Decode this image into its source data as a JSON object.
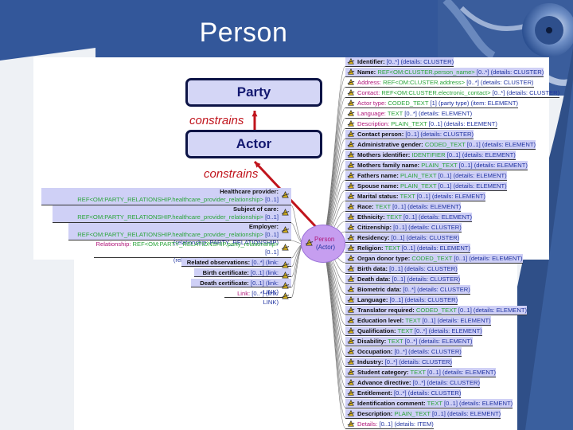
{
  "slide": {
    "title": "Person",
    "colors": {
      "header_blue": "#33579a",
      "node_fill": "#cfd0f6",
      "arrow_red": "#c0141c",
      "center_fill": "#c69ef0"
    }
  },
  "hierarchy": {
    "boxes": [
      {
        "label": "Party"
      },
      {
        "label": "Actor"
      }
    ],
    "relations": [
      {
        "label": "constrains"
      },
      {
        "label": "constrains"
      }
    ]
  },
  "mindmap": {
    "center": {
      "title": "Person",
      "subtitle": "(Actor)",
      "icon": "compass-icon"
    },
    "right_nodes": [
      {
        "label": "Identifier:",
        "type": "",
        "ext": "[0..*] (details: CLUSTER)",
        "hl": true,
        "mag": false
      },
      {
        "label": "Name:",
        "type": "REF<OM:CLUSTER.person_name>",
        "ext": "[0..*] (details: CLUSTER)",
        "hl": true,
        "mag": false
      },
      {
        "label": "Address:",
        "type": "REF<OM:CLUSTER.address>",
        "ext": "[0..*] (details: CLUSTER)",
        "hl": false,
        "mag": true
      },
      {
        "label": "Contact:",
        "type": "REF<OM:CLUSTER.electronic_contact>",
        "ext": "[0..*] (details: CLUSTER)",
        "hl": false,
        "mag": true
      },
      {
        "label": "Actor type:",
        "type": "CODED_TEXT",
        "ext": "[1] (party type) (item: ELEMENT)",
        "hl": false,
        "mag": true
      },
      {
        "label": "Language:",
        "type": "TEXT",
        "ext": "[0..*] (details: ELEMENT)",
        "hl": false,
        "mag": true
      },
      {
        "label": "Description:",
        "type": "PLAIN_TEXT",
        "ext": "[0..1] (details: ELEMENT)",
        "hl": false,
        "mag": true
      },
      {
        "label": "Contact person:",
        "type": "",
        "ext": "[0..1] (details: CLUSTER)",
        "hl": true,
        "mag": false
      },
      {
        "label": "Administrative gender:",
        "type": "CODED_TEXT",
        "ext": "[0..1] (details: ELEMENT)",
        "hl": true,
        "mag": false
      },
      {
        "label": "Mothers identifier:",
        "type": "IDENTIFIER",
        "ext": "[0..1] (details: ELEMENT)",
        "hl": true,
        "mag": false
      },
      {
        "label": "Mothers family name:",
        "type": "PLAIN_TEXT",
        "ext": "[0..1] (details: ELEMENT)",
        "hl": true,
        "mag": false
      },
      {
        "label": "Fathers name:",
        "type": "PLAIN_TEXT",
        "ext": "[0..1] (details: ELEMENT)",
        "hl": true,
        "mag": false
      },
      {
        "label": "Spouse name:",
        "type": "PLAIN_TEXT",
        "ext": "[0..1] (details: ELEMENT)",
        "hl": true,
        "mag": false
      },
      {
        "label": "Marital status:",
        "type": "TEXT",
        "ext": "[0..1] (details: ELEMENT)",
        "hl": true,
        "mag": false
      },
      {
        "label": "Race:",
        "type": "TEXT",
        "ext": "[0..1] (details: ELEMENT)",
        "hl": true,
        "mag": false
      },
      {
        "label": "Ethnicity:",
        "type": "TEXT",
        "ext": "[0..1] (details: ELEMENT)",
        "hl": true,
        "mag": false
      },
      {
        "label": "Citizenship:",
        "type": "",
        "ext": "[0..1] (details: CLUSTER)",
        "hl": true,
        "mag": false
      },
      {
        "label": "Residency:",
        "type": "",
        "ext": "[0..1] (details: CLUSTER)",
        "hl": true,
        "mag": false
      },
      {
        "label": "Religion:",
        "type": "TEXT",
        "ext": "[0..1] (details: ELEMENT)",
        "hl": true,
        "mag": false
      },
      {
        "label": "Organ donor type:",
        "type": "CODED_TEXT",
        "ext": "[0..1] (details: ELEMENT)",
        "hl": true,
        "mag": false
      },
      {
        "label": "Birth data:",
        "type": "",
        "ext": "[0..1] (details: CLUSTER)",
        "hl": true,
        "mag": false
      },
      {
        "label": "Death data:",
        "type": "",
        "ext": "[0..1] (details: CLUSTER)",
        "hl": true,
        "mag": false
      },
      {
        "label": "Biometric data:",
        "type": "",
        "ext": "[0..*] (details: CLUSTER)",
        "hl": true,
        "mag": false
      },
      {
        "label": "Language:",
        "type": "",
        "ext": "[0..1] (details: CLUSTER)",
        "hl": true,
        "mag": false
      },
      {
        "label": "Translator required:",
        "type": "CODED_TEXT",
        "ext": "[0..1] (details: ELEMENT)",
        "hl": true,
        "mag": false
      },
      {
        "label": "Education level:",
        "type": "TEXT",
        "ext": "[0..1] (details: ELEMENT)",
        "hl": true,
        "mag": false
      },
      {
        "label": "Qualification:",
        "type": "TEXT",
        "ext": "[0..*] (details: ELEMENT)",
        "hl": true,
        "mag": false
      },
      {
        "label": "Disability:",
        "type": "TEXT",
        "ext": "[0..*] (details: ELEMENT)",
        "hl": true,
        "mag": false
      },
      {
        "label": "Occupation:",
        "type": "",
        "ext": "[0..*] (details: CLUSTER)",
        "hl": true,
        "mag": false
      },
      {
        "label": "Industry:",
        "type": "",
        "ext": "[0..*] (details: CLUSTER)",
        "hl": true,
        "mag": false
      },
      {
        "label": "Student category:",
        "type": "TEXT",
        "ext": "[0..1] (details: ELEMENT)",
        "hl": true,
        "mag": false
      },
      {
        "label": "Advance directive:",
        "type": "",
        "ext": "[0..*] (details: CLUSTER)",
        "hl": true,
        "mag": false
      },
      {
        "label": "Entitlement:",
        "type": "",
        "ext": "[0..*] (details: CLUSTER)",
        "hl": true,
        "mag": false
      },
      {
        "label": "Identification comment:",
        "type": "TEXT",
        "ext": "[0..1] (details: ELEMENT)",
        "hl": true,
        "mag": false
      },
      {
        "label": "Description:",
        "type": "PLAIN_TEXT",
        "ext": "[0..1] (details: ELEMENT)",
        "hl": true,
        "mag": false
      },
      {
        "label": "Details:",
        "type": "",
        "ext": "[0..1] (details: ITEM)",
        "hl": false,
        "mag": true
      }
    ],
    "left_nodes": [
      {
        "label": "Healthcare provider:",
        "type": "REF<OM:PARTY_RELATIONSHIP.healthcare_provider_relationship>",
        "ext": "[0..1]",
        "line2": "(relationship: PARTY_RELATIONSHIP)",
        "hl": true,
        "mag": false
      },
      {
        "label": "Subject of care:",
        "type": "REF<OM:PARTY_RELATIONSHIP.healthcare_provider_relationship>",
        "ext": "[0..1]",
        "line2": "(relationship: PARTY_RELATIONSHIP)",
        "hl": true,
        "mag": false
      },
      {
        "label": "Employer:",
        "type": "REF<OM:PARTY_RELATIONSHIP.healthcare_provider_relationship>",
        "ext": "[0..1]",
        "line2": "(relationship: PARTY_RELATIONSHIP)",
        "hl": true,
        "mag": false
      },
      {
        "label": "Relationship:",
        "type": "REF<OM:PARTY_RELATIONSHIP.party_relationship>",
        "ext": "[0..1]",
        "line2": "(relationship: PARTY_RELATIONSHIP)",
        "hl": false,
        "mag": true
      },
      {
        "label": "Related observations:",
        "type": "",
        "ext": "[0..*] (link: LINK)",
        "line2": "",
        "hl": true,
        "mag": false
      },
      {
        "label": "Birth certificate:",
        "type": "",
        "ext": "[0..1] (link: LINK)",
        "line2": "",
        "hl": true,
        "mag": false
      },
      {
        "label": "Death certificate:",
        "type": "",
        "ext": "[0..1] (link: LINK)",
        "line2": "",
        "hl": true,
        "mag": false
      },
      {
        "label": "Link:",
        "type": "",
        "ext": "[0..*] (link: LINK)",
        "line2": "",
        "hl": false,
        "mag": true
      }
    ]
  }
}
